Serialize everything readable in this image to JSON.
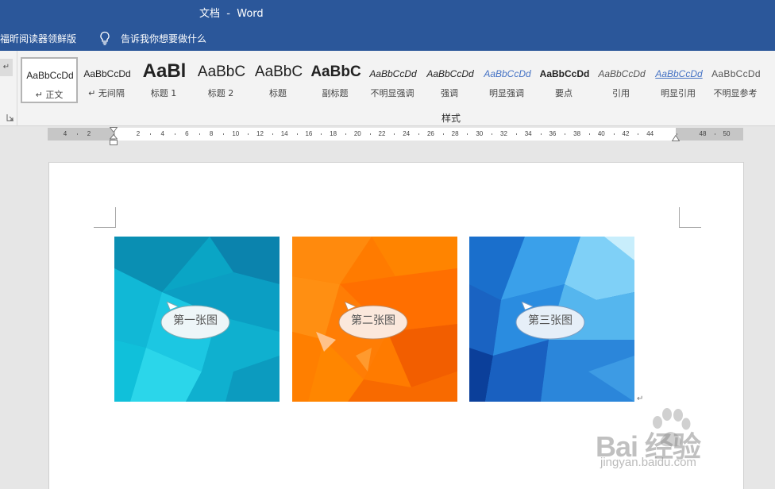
{
  "window": {
    "title": "文档  -  Word"
  },
  "tellbar": {
    "foxit_tab": "福昕阅读器领鲜版",
    "tell_me": "告诉我你想要做什么"
  },
  "styles_group": {
    "name": "样式",
    "items": [
      {
        "sample": "AaBbCcDd",
        "label": "↵ 正文",
        "selected": true
      },
      {
        "sample": "AaBbCcDd",
        "label": "↵ 无间隔"
      },
      {
        "sample": "AaBl",
        "label": "标题 1"
      },
      {
        "sample": "AaBbC",
        "label": "标题 2"
      },
      {
        "sample": "AaBbC",
        "label": "标题"
      },
      {
        "sample": "AaBbC",
        "label": "副标题"
      },
      {
        "sample": "AaBbCcDd",
        "label": "不明显强调"
      },
      {
        "sample": "AaBbCcDd",
        "label": "强调"
      },
      {
        "sample": "AaBbCcDd",
        "label": "明显强调"
      },
      {
        "sample": "AaBbCcDd",
        "label": "要点"
      },
      {
        "sample": "AaBbCcDd",
        "label": "引用"
      },
      {
        "sample": "AaBbCcDd",
        "label": "明显引用"
      },
      {
        "sample": "AaBbCcDd",
        "label": "不明显参考"
      }
    ]
  },
  "ruler": {
    "ticks": [
      "4",
      "2",
      "2",
      "4",
      "6",
      "8",
      "10",
      "12",
      "14",
      "16",
      "18",
      "20",
      "22",
      "24",
      "26",
      "28",
      "30",
      "32",
      "34",
      "36",
      "38",
      "40",
      "42",
      "44",
      "48",
      "50"
    ]
  },
  "document": {
    "images": [
      {
        "caption": "第一张图"
      },
      {
        "caption": "第二张图"
      },
      {
        "caption": "第三张图"
      }
    ],
    "paragraph_mark": "↵"
  },
  "watermark": {
    "brand": "Bai  经验",
    "url": "jingyan.baidu.com"
  },
  "colors": {
    "title_bar": "#2b579a",
    "ribbon": "#f3f3f3",
    "workspace": "#e6e6e6",
    "image1": "#0fb4d1",
    "image2": "#ff7a00",
    "image3": "#1e7fd8"
  }
}
